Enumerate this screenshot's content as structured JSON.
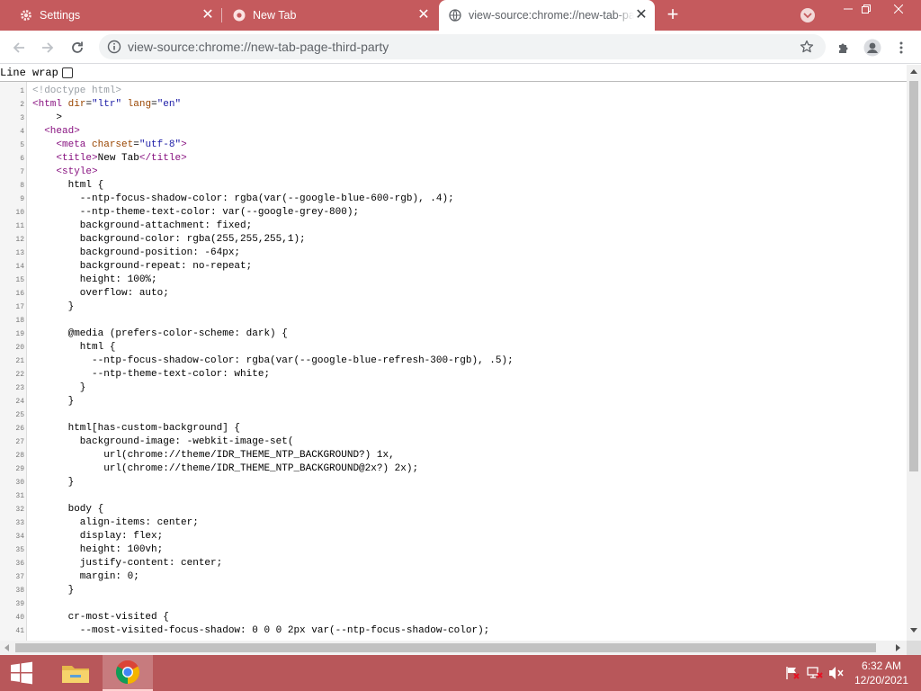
{
  "tabs": [
    {
      "title": "Settings",
      "favicon": "gear-icon",
      "active": false
    },
    {
      "title": "New Tab",
      "favicon": "chrome-tab-icon",
      "active": false
    },
    {
      "title": "view-source:chrome://new-tab-page-third-party",
      "favicon": "globe-icon",
      "active": true
    }
  ],
  "toolbar": {
    "url": "view-source:chrome://new-tab-page-third-party"
  },
  "content": {
    "line_wrap_label": "Line wrap",
    "line_wrap_checked": false
  },
  "source_lines": [
    {
      "n": "1",
      "text": "<!doctype html>"
    },
    {
      "n": "2",
      "text": "<html dir=\"ltr\" lang=\"en\""
    },
    {
      "n": "3",
      "text": "    >"
    },
    {
      "n": "4",
      "text": "  <head>"
    },
    {
      "n": "5",
      "text": "    <meta charset=\"utf-8\">"
    },
    {
      "n": "6",
      "text": "    <title>New Tab</title>"
    },
    {
      "n": "7",
      "text": "    <style>"
    },
    {
      "n": "8",
      "text": "      html {"
    },
    {
      "n": "9",
      "text": "        --ntp-focus-shadow-color: rgba(var(--google-blue-600-rgb), .4);"
    },
    {
      "n": "10",
      "text": "        --ntp-theme-text-color: var(--google-grey-800);"
    },
    {
      "n": "11",
      "text": "        background-attachment: fixed;"
    },
    {
      "n": "12",
      "text": "        background-color: rgba(255,255,255,1);"
    },
    {
      "n": "13",
      "text": "        background-position: -64px;"
    },
    {
      "n": "14",
      "text": "        background-repeat: no-repeat;"
    },
    {
      "n": "15",
      "text": "        height: 100%;"
    },
    {
      "n": "16",
      "text": "        overflow: auto;"
    },
    {
      "n": "17",
      "text": "      }"
    },
    {
      "n": "18",
      "text": ""
    },
    {
      "n": "19",
      "text": "      @media (prefers-color-scheme: dark) {"
    },
    {
      "n": "20",
      "text": "        html {"
    },
    {
      "n": "21",
      "text": "          --ntp-focus-shadow-color: rgba(var(--google-blue-refresh-300-rgb), .5);"
    },
    {
      "n": "22",
      "text": "          --ntp-theme-text-color: white;"
    },
    {
      "n": "23",
      "text": "        }"
    },
    {
      "n": "24",
      "text": "      }"
    },
    {
      "n": "25",
      "text": ""
    },
    {
      "n": "26",
      "text": "      html[has-custom-background] {"
    },
    {
      "n": "27",
      "text": "        background-image: -webkit-image-set("
    },
    {
      "n": "28",
      "text": "            url(chrome://theme/IDR_THEME_NTP_BACKGROUND?) 1x,"
    },
    {
      "n": "29",
      "text": "            url(chrome://theme/IDR_THEME_NTP_BACKGROUND@2x?) 2x);"
    },
    {
      "n": "30",
      "text": "      }"
    },
    {
      "n": "31",
      "text": ""
    },
    {
      "n": "32",
      "text": "      body {"
    },
    {
      "n": "33",
      "text": "        align-items: center;"
    },
    {
      "n": "34",
      "text": "        display: flex;"
    },
    {
      "n": "35",
      "text": "        height: 100vh;"
    },
    {
      "n": "36",
      "text": "        justify-content: center;"
    },
    {
      "n": "37",
      "text": "        margin: 0;"
    },
    {
      "n": "38",
      "text": "      }"
    },
    {
      "n": "39",
      "text": ""
    },
    {
      "n": "40",
      "text": "      cr-most-visited {"
    },
    {
      "n": "41",
      "text": "        --most-visited-focus-shadow: 0 0 0 2px var(--ntp-focus-shadow-color);"
    }
  ],
  "taskbar": {
    "time": "6:32 AM",
    "date": "12/20/2021"
  },
  "colors": {
    "tabstrip": "#c55a5d",
    "taskbar": "#b8575a",
    "html_tag": "#881280",
    "html_attr": "#994500",
    "html_value": "#1a1aa6",
    "comment": "#9aa0a6"
  }
}
